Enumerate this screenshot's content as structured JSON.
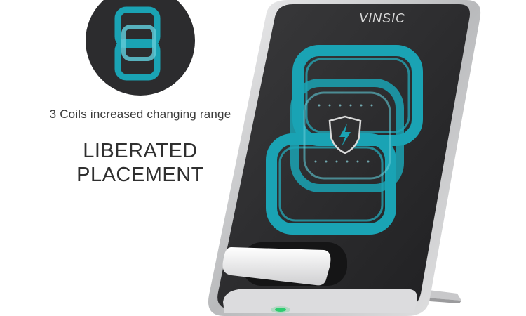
{
  "caption": "3 Coils increased changing range",
  "headline": {
    "line1": "LIBERATED",
    "line2": "PLACEMENT"
  },
  "product": {
    "brand": "VINSIC"
  },
  "colors": {
    "background": "#ffffff",
    "coil": "#1aa3b4",
    "device_body": "#2b2b2d",
    "frame": "#c9c9cb",
    "text": "#333333",
    "led": "#2ecc71"
  },
  "icons": [
    "coil-diagram-icon",
    "shield-bolt-icon",
    "led-indicator-icon"
  ]
}
